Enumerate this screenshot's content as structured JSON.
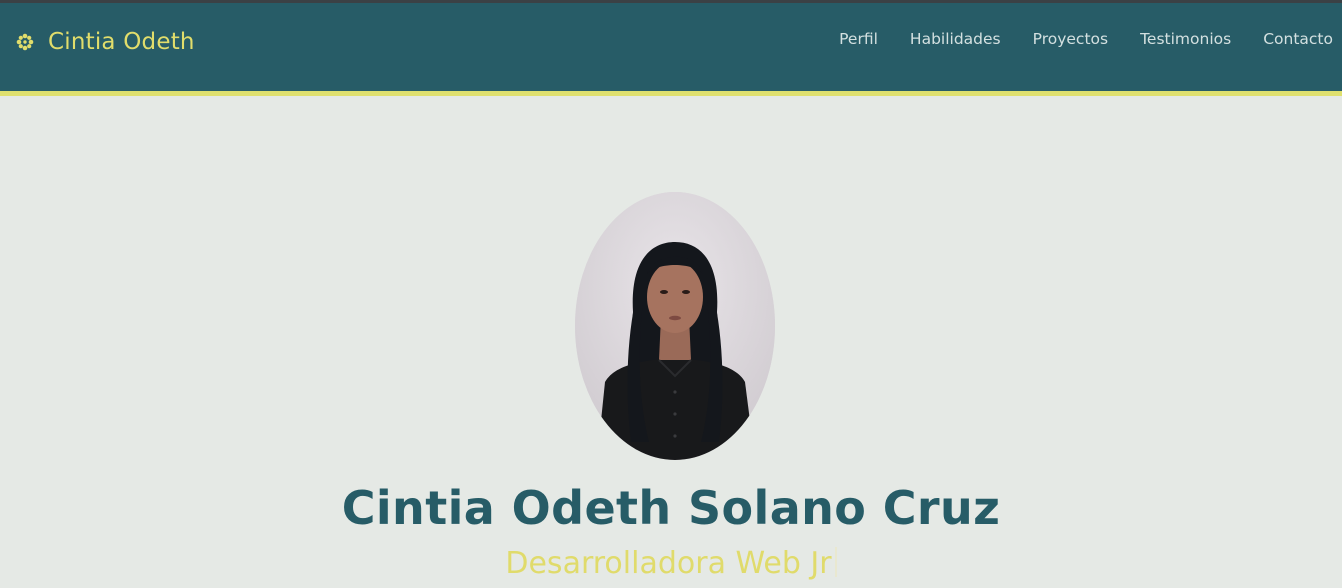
{
  "header": {
    "brand": "Cintia Odeth",
    "brand_icon": "flower-icon",
    "nav": [
      {
        "label": "Perfil"
      },
      {
        "label": "Habilidades"
      },
      {
        "label": "Proyectos"
      },
      {
        "label": "Testimonios"
      },
      {
        "label": "Contacto"
      }
    ]
  },
  "hero": {
    "photo_icon": "profile-photo",
    "name": "Cintia Odeth Solano Cruz",
    "role": "Desarrolladora Web Jr"
  },
  "colors": {
    "navbar": "#275c67",
    "accent": "#dfe06e",
    "background": "#e5e9e5"
  }
}
